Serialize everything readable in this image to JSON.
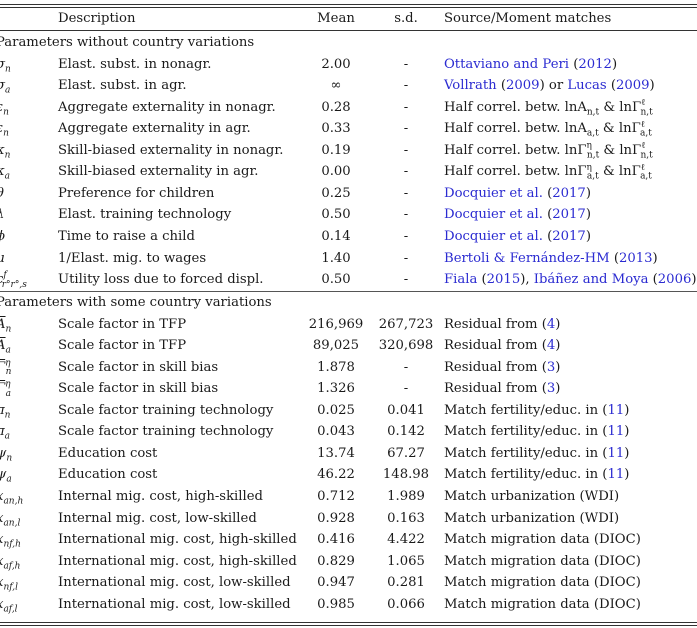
{
  "header": {
    "symbol": "",
    "description": "Description",
    "mean": "Mean",
    "sd": "s.d.",
    "source": "Source/Moment matches"
  },
  "sections": [
    {
      "title": "Parameters without country variations",
      "rows": [
        {
          "symbol": "σ",
          "sub": "n",
          "sup": "",
          "description": "Elast. subst. in nonagr.",
          "mean": "2.00",
          "sd": "-",
          "source": [
            {
              "t": "Ottaviano and Peri",
              "link": true
            },
            {
              "t": " (",
              "link": false
            },
            {
              "t": "2012",
              "link": true
            },
            {
              "t": ")",
              "link": false
            }
          ]
        },
        {
          "symbol": "σ",
          "sub": "a",
          "sup": "",
          "description": "Elast. subst. in agr.",
          "mean": "∞",
          "sd": "-",
          "source": [
            {
              "t": "Vollrath",
              "link": true
            },
            {
              "t": " (",
              "link": false
            },
            {
              "t": "2009",
              "link": true
            },
            {
              "t": ") or ",
              "link": false
            },
            {
              "t": "Lucas",
              "link": true
            },
            {
              "t": " (",
              "link": false
            },
            {
              "t": "2009",
              "link": true
            },
            {
              "t": ")",
              "link": false
            }
          ]
        },
        {
          "symbol": "ε",
          "sub": "n",
          "sup": "",
          "description": "Aggregate externality in nonagr.",
          "mean": "0.28",
          "sd": "-",
          "source": [
            {
              "t": "Half correl. betw. lnA",
              "link": false
            },
            {
              "t": "n,t",
              "sub": true
            },
            {
              "t": " & lnΓ",
              "link": false
            },
            {
              "t": "ℓ",
              "sup": true
            },
            {
              "t": "n,t",
              "sub": true
            }
          ]
        },
        {
          "symbol": "ε",
          "sub": "n",
          "sup": "",
          "description": "Aggregate externality in agr.",
          "mean": "0.33",
          "sd": "-",
          "source": [
            {
              "t": "Half correl. betw. lnA",
              "link": false
            },
            {
              "t": "a,t",
              "sub": true
            },
            {
              "t": " & lnΓ",
              "link": false
            },
            {
              "t": "ℓ",
              "sup": true
            },
            {
              "t": "a,t",
              "sub": true
            }
          ]
        },
        {
          "symbol": "κ",
          "sub": "n",
          "sup": "",
          "description": "Skill-biased externality in nonagr.",
          "mean": "0.19",
          "sd": "-",
          "source": [
            {
              "t": "Half correl. betw. lnΓ",
              "link": false
            },
            {
              "t": "η",
              "sup": true
            },
            {
              "t": "n,t",
              "sub": true
            },
            {
              "t": " & lnΓ",
              "link": false
            },
            {
              "t": "ℓ",
              "sup": true
            },
            {
              "t": "n,t",
              "sub": true
            }
          ]
        },
        {
          "symbol": "κ",
          "sub": "a",
          "sup": "",
          "description": "Skill-biased externality in agr.",
          "mean": "0.00",
          "sd": "-",
          "source": [
            {
              "t": "Half correl. betw. lnΓ",
              "link": false
            },
            {
              "t": "η",
              "sup": true
            },
            {
              "t": "a,t",
              "sub": true
            },
            {
              "t": " & lnΓ",
              "link": false
            },
            {
              "t": "ℓ",
              "sup": true
            },
            {
              "t": "a,t",
              "sub": true
            }
          ]
        },
        {
          "symbol": "θ",
          "sub": "",
          "sup": "",
          "description": "Preference for children",
          "mean": "0.25",
          "sd": "-",
          "source": [
            {
              "t": "Docquier et al.",
              "link": true
            },
            {
              "t": " (",
              "link": false
            },
            {
              "t": "2017",
              "link": true
            },
            {
              "t": ")",
              "link": false
            }
          ]
        },
        {
          "symbol": "λ",
          "sub": "",
          "sup": "",
          "description": "Elast. training technology",
          "mean": "0.50",
          "sd": "-",
          "source": [
            {
              "t": "Docquier et al.",
              "link": true
            },
            {
              "t": " (",
              "link": false
            },
            {
              "t": "2017",
              "link": true
            },
            {
              "t": ")",
              "link": false
            }
          ]
        },
        {
          "symbol": "ϕ",
          "sub": "",
          "sup": "",
          "description": "Time to raise a child",
          "mean": "0.14",
          "sd": "-",
          "source": [
            {
              "t": "Docquier et al.",
              "link": true
            },
            {
              "t": " (",
              "link": false
            },
            {
              "t": "2017",
              "link": true
            },
            {
              "t": ")",
              "link": false
            }
          ]
        },
        {
          "symbol": "μ",
          "sub": "",
          "sup": "",
          "description": "1/Elast. mig. to wages",
          "mean": "1.40",
          "sd": "-",
          "source": [
            {
              "t": "Bertoli & Fernández-HM",
              "link": true
            },
            {
              "t": " (",
              "link": false
            },
            {
              "t": "2013",
              "link": true
            },
            {
              "t": ")",
              "link": false
            }
          ]
        },
        {
          "symbol": "c",
          "sub": "r°r°,s",
          "sup": "f",
          "description": "Utility loss due to forced displ.",
          "mean": "0.50",
          "sd": "-",
          "source": [
            {
              "t": "Fiala",
              "link": true
            },
            {
              "t": " (",
              "link": false
            },
            {
              "t": "2015",
              "link": true
            },
            {
              "t": "), ",
              "link": false
            },
            {
              "t": "Ibáñez and Moya",
              "link": true
            },
            {
              "t": " (",
              "link": false
            },
            {
              "t": "2006",
              "link": true
            },
            {
              "t": ")",
              "link": false
            }
          ]
        }
      ]
    },
    {
      "title": "Parameters with some country variations",
      "rows": [
        {
          "symbol": "A",
          "overline": true,
          "sub": "n",
          "sup": "",
          "description": "Scale factor in TFP",
          "mean": "216,969",
          "sd": "267,723",
          "source": [
            {
              "t": "Residual from (",
              "link": false
            },
            {
              "t": "4",
              "link": true
            },
            {
              "t": ")",
              "link": false
            }
          ]
        },
        {
          "symbol": "A",
          "overline": true,
          "sub": "a",
          "sup": "",
          "description": "Scale factor in TFP",
          "mean": "89,025",
          "sd": "320,698",
          "source": [
            {
              "t": "Residual from (",
              "link": false
            },
            {
              "t": "4",
              "link": true
            },
            {
              "t": ")",
              "link": false
            }
          ]
        },
        {
          "symbol": "Γ",
          "overline": true,
          "sub": "n",
          "sup": "η",
          "description": "Scale factor in skill bias",
          "mean": "1.878",
          "sd": "-",
          "source": [
            {
              "t": "Residual from (",
              "link": false
            },
            {
              "t": "3",
              "link": true
            },
            {
              "t": ")",
              "link": false
            }
          ]
        },
        {
          "symbol": "Γ",
          "overline": true,
          "sub": "a",
          "sup": "η",
          "description": "Scale factor in skill bias",
          "mean": "1.326",
          "sd": "-",
          "source": [
            {
              "t": "Residual from (",
              "link": false
            },
            {
              "t": "3",
              "link": true
            },
            {
              "t": ")",
              "link": false
            }
          ]
        },
        {
          "symbol": "π",
          "sub": "n",
          "sup": "",
          "description": "Scale factor training technology",
          "mean": "0.025",
          "sd": "0.041",
          "source": [
            {
              "t": "Match fertility/educ. in (",
              "link": false
            },
            {
              "t": "11",
              "link": true
            },
            {
              "t": ")",
              "link": false
            }
          ]
        },
        {
          "symbol": "π",
          "sub": "a",
          "sup": "",
          "description": "Scale factor training technology",
          "mean": "0.043",
          "sd": "0.142",
          "source": [
            {
              "t": "Match fertility/educ. in (",
              "link": false
            },
            {
              "t": "11",
              "link": true
            },
            {
              "t": ")",
              "link": false
            }
          ]
        },
        {
          "symbol": "ψ",
          "sub": "n",
          "sup": "",
          "description": "Education cost",
          "mean": "13.74",
          "sd": "67.27",
          "source": [
            {
              "t": "Match fertility/educ. in (",
              "link": false
            },
            {
              "t": "11",
              "link": true
            },
            {
              "t": ")",
              "link": false
            }
          ]
        },
        {
          "symbol": "ψ",
          "sub": "a",
          "sup": "",
          "description": "Education cost",
          "mean": "46.22",
          "sd": "148.98",
          "source": [
            {
              "t": "Match fertility/educ. in (",
              "link": false
            },
            {
              "t": "11",
              "link": true
            },
            {
              "t": ")",
              "link": false
            }
          ]
        },
        {
          "symbol": "x",
          "sub": "an,h",
          "sup": "",
          "description": "Internal mig. cost, high-skilled",
          "mean": "0.712",
          "sd": "1.989",
          "source": [
            {
              "t": "Match urbanization (WDI)",
              "link": false
            }
          ]
        },
        {
          "symbol": "x",
          "sub": "an,l",
          "sup": "",
          "description": "Internal mig. cost, low-skilled",
          "mean": "0.928",
          "sd": "0.163",
          "source": [
            {
              "t": "Match urbanization (WDI)",
              "link": false
            }
          ]
        },
        {
          "symbol": "x",
          "sub": "nf,h",
          "sup": "",
          "description": "International mig. cost, high-skilled",
          "mean": "0.416",
          "sd": "4.422",
          "source": [
            {
              "t": "Match migration data (DIOC)",
              "link": false
            }
          ]
        },
        {
          "symbol": "x",
          "sub": "af,h",
          "sup": "",
          "description": "International mig. cost, high-skilled",
          "mean": "0.829",
          "sd": "1.065",
          "source": [
            {
              "t": "Match migration data (DIOC)",
              "link": false
            }
          ]
        },
        {
          "symbol": "x",
          "sub": "nf,l",
          "sup": "",
          "description": "International mig. cost, low-skilled",
          "mean": "0.947",
          "sd": "0.281",
          "source": [
            {
              "t": "Match migration data (DIOC)",
              "link": false
            }
          ]
        },
        {
          "symbol": "x",
          "sub": "af,l",
          "sup": "",
          "description": "International mig. cost, low-skilled",
          "mean": "0.985",
          "sd": "0.066",
          "source": [
            {
              "t": "Match migration data (DIOC)",
              "link": false
            }
          ]
        }
      ]
    }
  ],
  "colors": {
    "link": "#2b2bd1",
    "text": "#1a1a1a",
    "rule": "#333333"
  }
}
